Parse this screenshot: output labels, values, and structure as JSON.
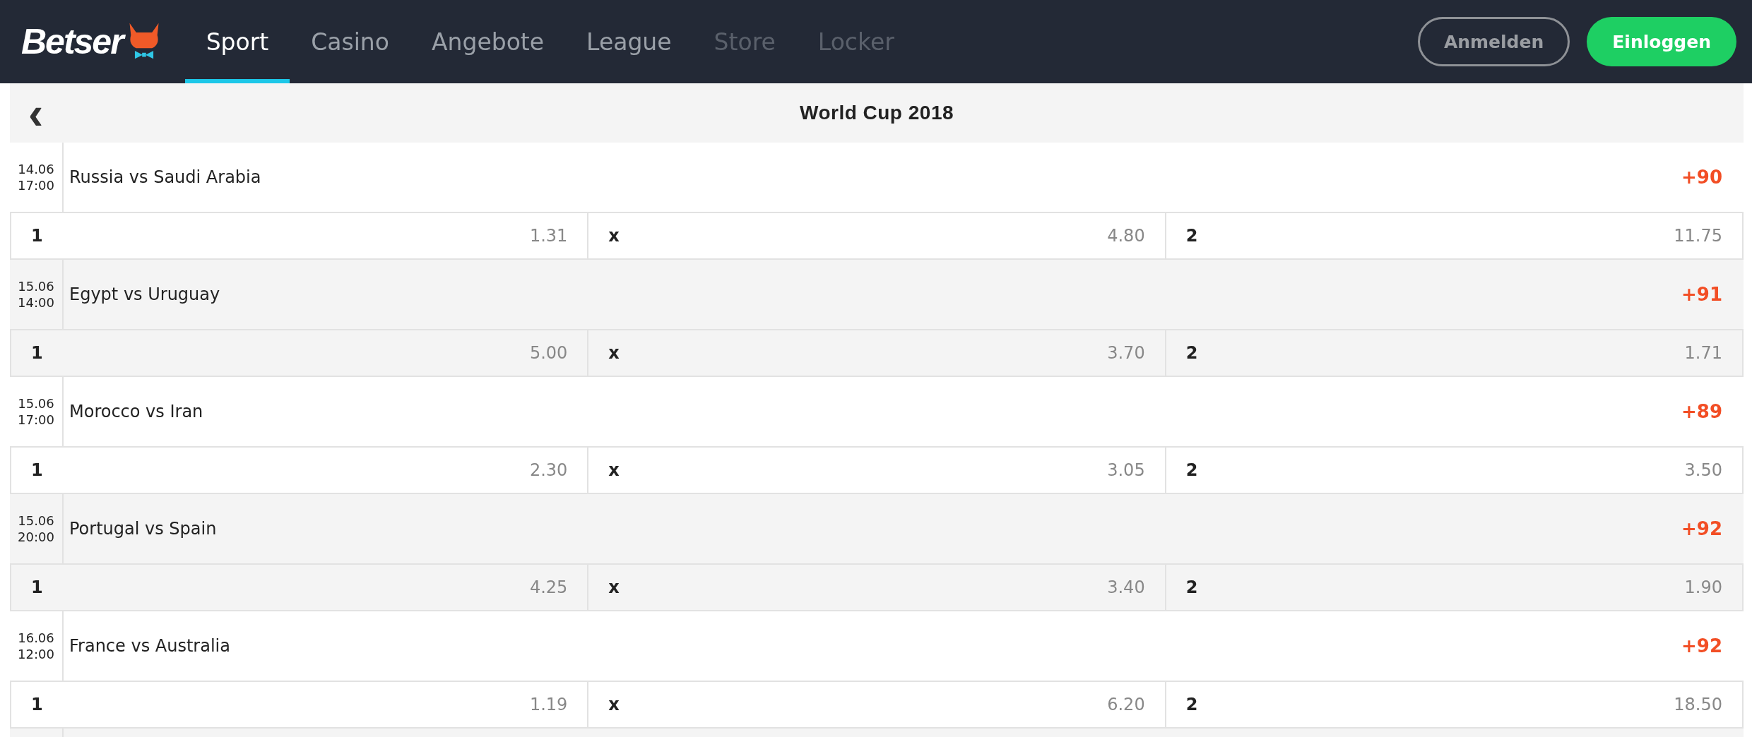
{
  "header": {
    "logo": "Betser",
    "nav": [
      {
        "label": "Sport",
        "selected": true,
        "disabled": false
      },
      {
        "label": "Casino",
        "selected": false,
        "disabled": false
      },
      {
        "label": "Angebote",
        "selected": false,
        "disabled": false
      },
      {
        "label": "League",
        "selected": false,
        "disabled": false
      },
      {
        "label": "Store",
        "selected": false,
        "disabled": true
      },
      {
        "label": "Locker",
        "selected": false,
        "disabled": true
      }
    ],
    "buttons": [
      {
        "label": "Anmelden",
        "kind": "outline"
      },
      {
        "label": "Einloggen",
        "kind": "primary"
      }
    ]
  },
  "title_bar": {
    "back": "‹",
    "title": "World Cup 2018"
  },
  "matches": [
    {
      "date": "14.06",
      "time": "17:00",
      "name": "Russia vs Saudi Arabia",
      "more": "+90",
      "odds": [
        {
          "label": "1",
          "value": "1.31"
        },
        {
          "label": "x",
          "value": "4.80"
        },
        {
          "label": "2",
          "value": "11.75"
        }
      ]
    },
    {
      "date": "15.06",
      "time": "14:00",
      "name": "Egypt vs Uruguay",
      "more": "+91",
      "odds": [
        {
          "label": "1",
          "value": "5.00"
        },
        {
          "label": "x",
          "value": "3.70"
        },
        {
          "label": "2",
          "value": "1.71"
        }
      ]
    },
    {
      "date": "15.06",
      "time": "17:00",
      "name": "Morocco vs Iran",
      "more": "+89",
      "odds": [
        {
          "label": "1",
          "value": "2.30"
        },
        {
          "label": "x",
          "value": "3.05"
        },
        {
          "label": "2",
          "value": "3.50"
        }
      ]
    },
    {
      "date": "15.06",
      "time": "20:00",
      "name": "Portugal vs Spain",
      "more": "+92",
      "odds": [
        {
          "label": "1",
          "value": "4.25"
        },
        {
          "label": "x",
          "value": "3.40"
        },
        {
          "label": "2",
          "value": "1.90"
        }
      ]
    },
    {
      "date": "16.06",
      "time": "12:00",
      "name": "France vs Australia",
      "more": "+92",
      "odds": [
        {
          "label": "1",
          "value": "1.19"
        },
        {
          "label": "x",
          "value": "6.20"
        },
        {
          "label": "2",
          "value": "18.50"
        }
      ]
    }
  ]
}
